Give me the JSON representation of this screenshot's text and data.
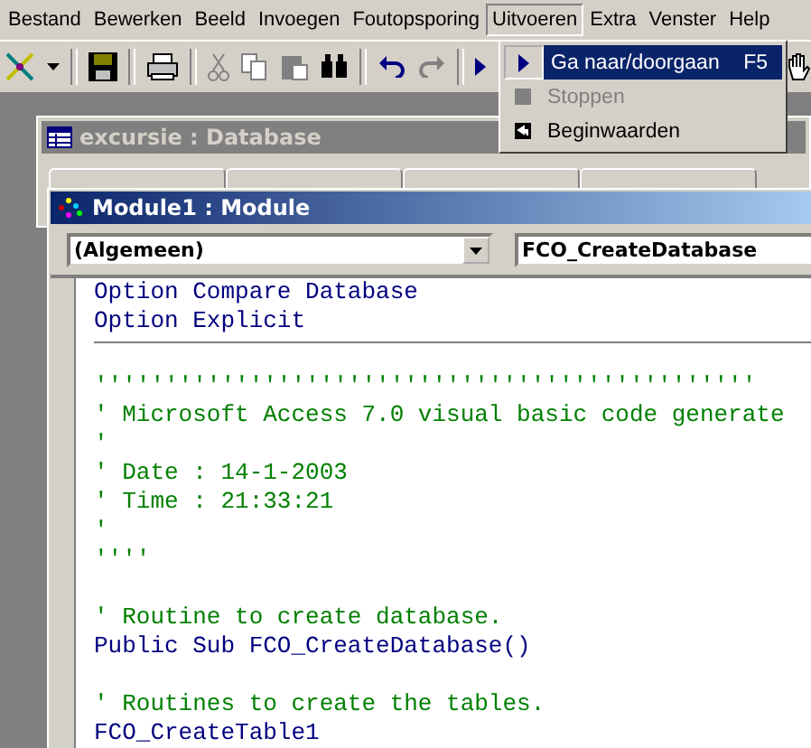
{
  "menu_bar": [
    {
      "label": "Bestand",
      "selected": false
    },
    {
      "label": "Bewerken",
      "selected": false
    },
    {
      "label": "Beeld",
      "selected": false
    },
    {
      "label": "Invoegen",
      "selected": false
    },
    {
      "label": "Foutopsporing",
      "selected": false
    },
    {
      "label": "Uitvoeren",
      "selected": true
    },
    {
      "label": "Extra",
      "selected": false
    },
    {
      "label": "Venster",
      "selected": false
    },
    {
      "label": "Help",
      "selected": false
    }
  ],
  "dropdown_menu": [
    {
      "label": "Ga naar/doorgaan",
      "shortcut": "F5",
      "selected": true,
      "disabled": false,
      "kind": "run"
    },
    {
      "label": "Stoppen",
      "selected": false,
      "disabled": true,
      "kind": "stop"
    },
    {
      "label": "Beginwaarden",
      "selected": false,
      "disabled": false,
      "kind": "reset"
    }
  ],
  "database_window": {
    "title": "excursie : Database"
  },
  "module_window": {
    "title": "Module1 : Module",
    "object_dropdown": "(Algemeen)",
    "procedure_dropdown": "FCO_CreateDatabase"
  },
  "declarations": [
    {
      "text": "Option Compare Database",
      "kind": "code"
    },
    {
      "text": "Option Explicit",
      "kind": "code"
    }
  ],
  "code_lines": [
    {
      "kind": "blank"
    },
    {
      "text": "'''''''''''''''''''''''''''''''''''''''''''''''",
      "kind": "comment"
    },
    {
      "text": "' Microsoft Access 7.0 visual basic code generate",
      "kind": "comment"
    },
    {
      "text": "'",
      "kind": "comment"
    },
    {
      "text": "' Date : 14-1-2003",
      "kind": "comment"
    },
    {
      "text": "' Time : 21:33:21",
      "kind": "comment"
    },
    {
      "text": "'",
      "kind": "comment"
    },
    {
      "text": "''''",
      "kind": "comment"
    },
    {
      "kind": "blank"
    },
    {
      "text": "' Routine to create database.",
      "kind": "comment"
    },
    {
      "text": "Public Sub FCO_CreateDatabase()",
      "kind": "code"
    },
    {
      "kind": "blank"
    },
    {
      "text": "' Routines to create the tables.",
      "kind": "comment"
    },
    {
      "text": "FCO_CreateTable1",
      "kind": "code"
    }
  ]
}
